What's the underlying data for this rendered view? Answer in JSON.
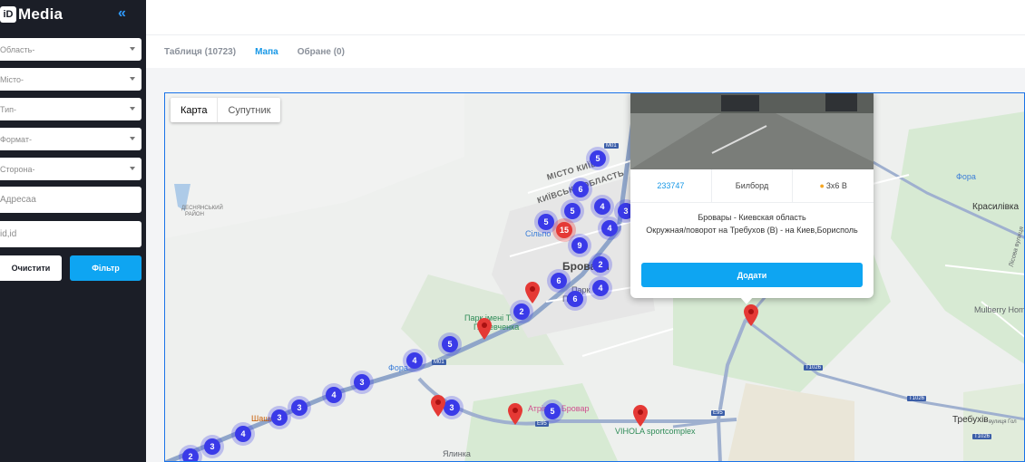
{
  "sidebar": {
    "logo_badge": "iD",
    "logo_text": "Media",
    "collapse_icon": "«",
    "selects": [
      "Область-",
      "Місто-",
      "Тип-",
      "Формат-",
      "Сторона-"
    ],
    "address_placeholder": "Адресаа",
    "id_placeholder": "id,id",
    "clear_label": "Очистити",
    "filter_label": "Фільтр"
  },
  "tabs": [
    "Таблиця (10723)",
    "Мапа",
    "Обране (0)"
  ],
  "map": {
    "maptype_map": "Карта",
    "maptype_sat": "Супутник",
    "labels": {
      "misto_kyiv": "МІСТО КИЇВ",
      "kyivska_oblast": "КИЇВСЬКА ОБЛАСТЬ",
      "desnianskyi": "ДЕСНЯНСЬКИЙ",
      "raion": "РАЙОН",
      "brovary": "Бровари",
      "park": "Парк імені Т.",
      "park2": "Г. Шевченка",
      "fora": "Фора",
      "fora2": "Фора",
      "krasylivka": "Красилівка",
      "mulberry": "Mulberry Hom",
      "trebukhiv": "Требухів",
      "trebukhiv_street": "вулиця Гол",
      "vihola": "VIHOLA sportcomplex",
      "yalynka": "Ялинка",
      "shashlyk": "Шашлик",
      "brovary_center": "Атрівіа • Бровар",
      "silpo": "Сільпо",
      "park_short": "Парк",
      "park_short2": "Парк",
      "lisova": "Лісова вулиця"
    },
    "shields": [
      "M01",
      "M01",
      "E95",
      "E95",
      "T1026",
      "T1026",
      "T1026"
    ],
    "clusters": [
      "5",
      "6",
      "4",
      "3",
      "5",
      "5",
      "15",
      "4",
      "9",
      "2",
      "6",
      "4",
      "6",
      "2",
      "5",
      "4",
      "3",
      "4",
      "3",
      "3",
      "4",
      "3",
      "2",
      "3",
      "5"
    ],
    "red_cluster_index": 6
  },
  "popup": {
    "id": "233747",
    "type": "Билборд",
    "size": "3x6 В",
    "location_icon": "pin-icon",
    "address_line1": "Бровары - Киевская область",
    "address_line2": "Окружная/поворот на Требухов (В) - на Киев,Борисполь",
    "add_label": "Додати"
  },
  "colors": {
    "accent": "#0ea5f2",
    "sidebar_bg": "#1b1e27",
    "cluster": "#3a3ae8",
    "pin": "#e53935"
  }
}
